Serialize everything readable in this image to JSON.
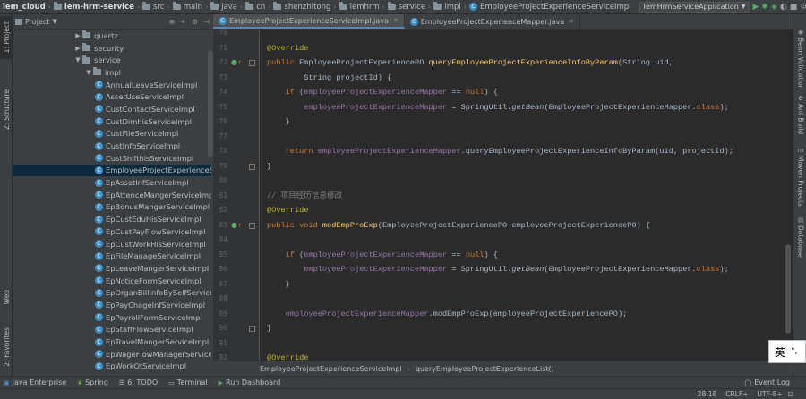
{
  "navbar": {
    "crumbs": [
      "iem_cloud",
      "iem-hrm-service",
      "src",
      "main",
      "java",
      "cn",
      "shenzhitong",
      "iemhrm",
      "service",
      "impl",
      "EmployeeProjectExperienceServiceImpl"
    ],
    "run_config": "IemHrmServiceApplication"
  },
  "left_tabs": [
    "1: Project",
    "Z: Structure",
    "Web",
    "2: Favorites"
  ],
  "project_panel": {
    "title": "Project",
    "tree": [
      {
        "label": "quartz",
        "type": "folder",
        "indent": 1,
        "arrow": "▶"
      },
      {
        "label": "security",
        "type": "folder",
        "indent": 1,
        "arrow": "▶"
      },
      {
        "label": "service",
        "type": "folder",
        "indent": 1,
        "arrow": "▼"
      },
      {
        "label": "impl",
        "type": "folder",
        "indent": 2,
        "arrow": "▼"
      },
      {
        "label": "AnnualLeaveServiceImpl",
        "type": "class",
        "indent": 3
      },
      {
        "label": "AssetUseServiceImpl",
        "type": "class",
        "indent": 3
      },
      {
        "label": "CustContactServiceImpl",
        "type": "class",
        "indent": 3
      },
      {
        "label": "CustDimhisServiceImpl",
        "type": "class",
        "indent": 3
      },
      {
        "label": "CustFileServiceImpl",
        "type": "class",
        "indent": 3
      },
      {
        "label": "CustInfoServiceImpl",
        "type": "class",
        "indent": 3
      },
      {
        "label": "CustShifthisServiceImpl",
        "type": "class",
        "indent": 3
      },
      {
        "label": "EmployeeProjectExperienceServiceImpl",
        "type": "class",
        "indent": 3,
        "selected": true
      },
      {
        "label": "EpAssetInfServiceImpl",
        "type": "class",
        "indent": 3
      },
      {
        "label": "EpAttenceMangerServiceImpl",
        "type": "class",
        "indent": 3
      },
      {
        "label": "EpBonusMangerServiceImpl",
        "type": "class",
        "indent": 3
      },
      {
        "label": "EpCustEduHisServiceImpl",
        "type": "class",
        "indent": 3
      },
      {
        "label": "EpCustPayFlowServiceImpl",
        "type": "class",
        "indent": 3
      },
      {
        "label": "EpCustWorkHisServiceImpl",
        "type": "class",
        "indent": 3
      },
      {
        "label": "EpFileManageServiceImpl",
        "type": "class",
        "indent": 3
      },
      {
        "label": "EpLeaveMangerServiceImpl",
        "type": "class",
        "indent": 3
      },
      {
        "label": "EpNoticeFormServiceImpl",
        "type": "class",
        "indent": 3
      },
      {
        "label": "EpOrganBillInfoBySelfServiceImpl",
        "type": "class",
        "indent": 3
      },
      {
        "label": "EpPayChageInfServiceImpl",
        "type": "class",
        "indent": 3
      },
      {
        "label": "EpPayrollFormServiceImpl",
        "type": "class",
        "indent": 3
      },
      {
        "label": "EpStaffFlowServiceImpl",
        "type": "class",
        "indent": 3
      },
      {
        "label": "EpTravelMangerServiceImpl",
        "type": "class",
        "indent": 3
      },
      {
        "label": "EpWageFlowManagerServiceImpl",
        "type": "class",
        "indent": 3
      },
      {
        "label": "EpWorkOtServiceImpl",
        "type": "class",
        "indent": 3
      }
    ]
  },
  "editor": {
    "tabs": [
      {
        "label": "EmployeeProjectExperienceServiceImpl.java",
        "active": true
      },
      {
        "label": "EmployeeProjectExperienceMapper.java",
        "active": false
      }
    ],
    "lines": [
      {
        "n": "70",
        "code": []
      },
      {
        "n": "71",
        "code": [
          [
            "ann",
            "@Override"
          ]
        ]
      },
      {
        "n": "72",
        "mark": true,
        "code": [
          [
            "kw",
            "public "
          ],
          [
            "",
            "EmployeeProjectExperiencePO "
          ],
          [
            "mth",
            "queryEmployeeProjectExperienceInfoByParam"
          ],
          [
            "",
            "(String uid,"
          ]
        ]
      },
      {
        "n": "73",
        "code": [
          [
            "",
            "        String projectId) {"
          ]
        ]
      },
      {
        "n": "74",
        "code": [
          [
            "",
            "    "
          ],
          [
            "kw",
            "if "
          ],
          [
            "",
            "("
          ],
          [
            "fld",
            "employeeProjectExperienceMapper"
          ],
          [
            "",
            " == "
          ],
          [
            "kw",
            "null"
          ],
          [
            "",
            ") {"
          ]
        ]
      },
      {
        "n": "75",
        "code": [
          [
            "",
            "        "
          ],
          [
            "fld",
            "employeeProjectExperienceMapper"
          ],
          [
            "",
            " = SpringUtil."
          ],
          [
            "stat",
            "getBean"
          ],
          [
            "",
            "(EmployeeProjectExperienceMapper."
          ],
          [
            "kw",
            "class"
          ],
          [
            "",
            ");"
          ]
        ]
      },
      {
        "n": "76",
        "code": [
          [
            "",
            "    }"
          ]
        ]
      },
      {
        "n": "77",
        "code": []
      },
      {
        "n": "78",
        "code": [
          [
            "",
            "    "
          ],
          [
            "kw",
            "return "
          ],
          [
            "fld",
            "employeeProjectExperienceMapper"
          ],
          [
            "",
            ".queryEmployeeProjectExperienceInfoByParam(uid, projectId);"
          ]
        ]
      },
      {
        "n": "79",
        "code": [
          [
            "",
            "}"
          ]
        ]
      },
      {
        "n": "80",
        "code": []
      },
      {
        "n": "81",
        "code": [
          [
            "cmt",
            "// 项目经历信息修改"
          ]
        ]
      },
      {
        "n": "82",
        "code": [
          [
            "ann",
            "@Override"
          ]
        ]
      },
      {
        "n": "83",
        "mark": true,
        "code": [
          [
            "kw",
            "public void "
          ],
          [
            "mth",
            "modEmpProExp"
          ],
          [
            "",
            "(EmployeeProjectExperiencePO employeeProjectExperiencePO) {"
          ]
        ]
      },
      {
        "n": "84",
        "code": []
      },
      {
        "n": "85",
        "code": [
          [
            "",
            "    "
          ],
          [
            "kw",
            "if "
          ],
          [
            "",
            "("
          ],
          [
            "fld",
            "employeeProjectExperienceMapper"
          ],
          [
            "",
            " == "
          ],
          [
            "kw",
            "null"
          ],
          [
            "",
            ") {"
          ]
        ]
      },
      {
        "n": "86",
        "code": [
          [
            "",
            "        "
          ],
          [
            "fld",
            "employeeProjectExperienceMapper"
          ],
          [
            "",
            " = SpringUtil."
          ],
          [
            "stat",
            "getBean"
          ],
          [
            "",
            "(EmployeeProjectExperienceMapper."
          ],
          [
            "kw",
            "class"
          ],
          [
            "",
            ");"
          ]
        ]
      },
      {
        "n": "87",
        "code": [
          [
            "",
            "    }"
          ]
        ]
      },
      {
        "n": "88",
        "code": []
      },
      {
        "n": "89",
        "code": [
          [
            "",
            "    "
          ],
          [
            "fld",
            "employeeProjectExperienceMapper"
          ],
          [
            "",
            ".modEmpProExp(employeeProjectExperiencePO);"
          ]
        ]
      },
      {
        "n": "90",
        "code": [
          [
            "",
            "}"
          ]
        ]
      },
      {
        "n": "91",
        "code": []
      },
      {
        "n": "92",
        "code": [
          [
            "ann",
            "@Override"
          ]
        ]
      }
    ],
    "breadcrumbs": [
      "EmployeeProjectExperienceServiceImpl",
      "queryEmployeeProjectExperienceList()"
    ]
  },
  "right_tabs": [
    "Bean Validation",
    "Ant Build",
    "Maven Projects",
    "Database"
  ],
  "ime": {
    "char": "英",
    "punct": "°,"
  },
  "bottom_tools": [
    "Java Enterprise",
    "Spring",
    "6: TODO",
    "Terminal",
    "Run Dashboard"
  ],
  "event_log": "Event Log",
  "status": {
    "position": "28:18",
    "line_sep": "CRLF÷",
    "encoding": "UTF-8÷"
  },
  "colors": {
    "background": "#2b2b2b",
    "panel": "#3c3f41",
    "selection": "#0d293e",
    "keyword": "#cc7832",
    "annotation": "#bbb529",
    "field": "#9876aa",
    "method": "#ffc66d",
    "comment": "#808080"
  }
}
